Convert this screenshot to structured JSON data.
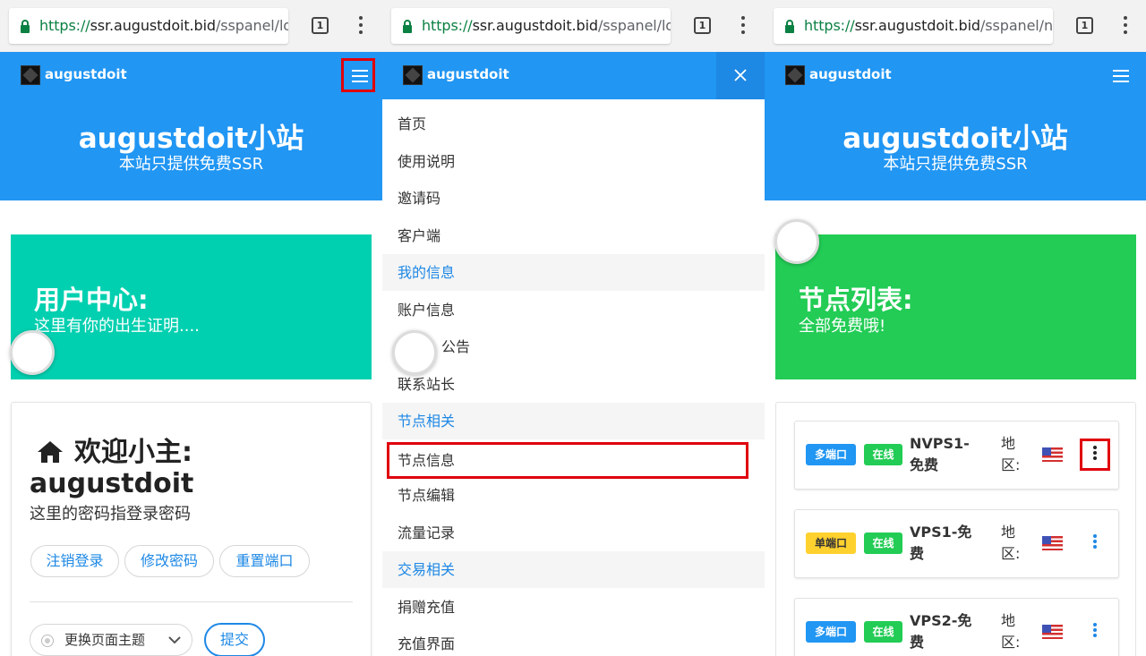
{
  "colors": {
    "primary": "#2196f3",
    "teal": "#00d0b0",
    "green": "#22cc55",
    "highlight_red": "#e0000b"
  },
  "panel1": {
    "url": {
      "scheme": "https://",
      "host": "ssr.augustdoit.bid",
      "path": "/sspanel/log"
    },
    "tab_count": "1",
    "brand": "augustdoit",
    "hero_title": "augustdoit小站",
    "hero_subtitle": "本站只提供免费SSR",
    "card_title": "用户中心:",
    "card_subtitle": "这里有你的出生证明....",
    "welcome_title": "欢迎小主:",
    "welcome_user": "augustdoit",
    "welcome_desc": "这里的密码指登录密码",
    "buttons": {
      "logout": "注销登录",
      "change_password": "修改密码",
      "reset_port": "重置端口"
    },
    "theme_select": "更换页面主题",
    "submit": "提交"
  },
  "panel2": {
    "url": {
      "scheme": "https://",
      "host": "ssr.augustdoit.bid",
      "path": "/sspanel/log"
    },
    "tab_count": "1",
    "brand": "augustdoit",
    "menu": [
      {
        "label": "首页",
        "section": false
      },
      {
        "label": "使用说明",
        "section": false
      },
      {
        "label": "邀请码",
        "section": false
      },
      {
        "label": "客户端",
        "section": false
      },
      {
        "label": "我的信息",
        "section": true
      },
      {
        "label": "账户信息",
        "section": false
      },
      {
        "label": "公告",
        "section": false
      },
      {
        "label": "联系站长",
        "section": false
      },
      {
        "label": "节点相关",
        "section": true
      },
      {
        "label": "节点信息",
        "section": false
      },
      {
        "label": "节点编辑",
        "section": false
      },
      {
        "label": "流量记录",
        "section": false
      },
      {
        "label": "交易相关",
        "section": true
      },
      {
        "label": "捐赠充值",
        "section": false
      },
      {
        "label": "充值界面",
        "section": false
      }
    ]
  },
  "panel3": {
    "url": {
      "scheme": "https://",
      "host": "ssr.augustdoit.bid",
      "path": "/sspanel/no"
    },
    "tab_count": "1",
    "brand": "augustdoit",
    "hero_title": "augustdoit小站",
    "hero_subtitle": "本站只提供免费SSR",
    "card_title": "节点列表:",
    "card_subtitle": "全部免费哦!",
    "nodes": [
      {
        "port_type": "多端口",
        "status": "在线",
        "name": "NVPS1-免费",
        "region_label": "地区:"
      },
      {
        "port_type": "单端口",
        "status": "在线",
        "name": "VPS1-免费",
        "region_label": "地区:"
      },
      {
        "port_type": "多端口",
        "status": "在线",
        "name": "VPS2-免费",
        "region_label": "地区:"
      }
    ]
  }
}
